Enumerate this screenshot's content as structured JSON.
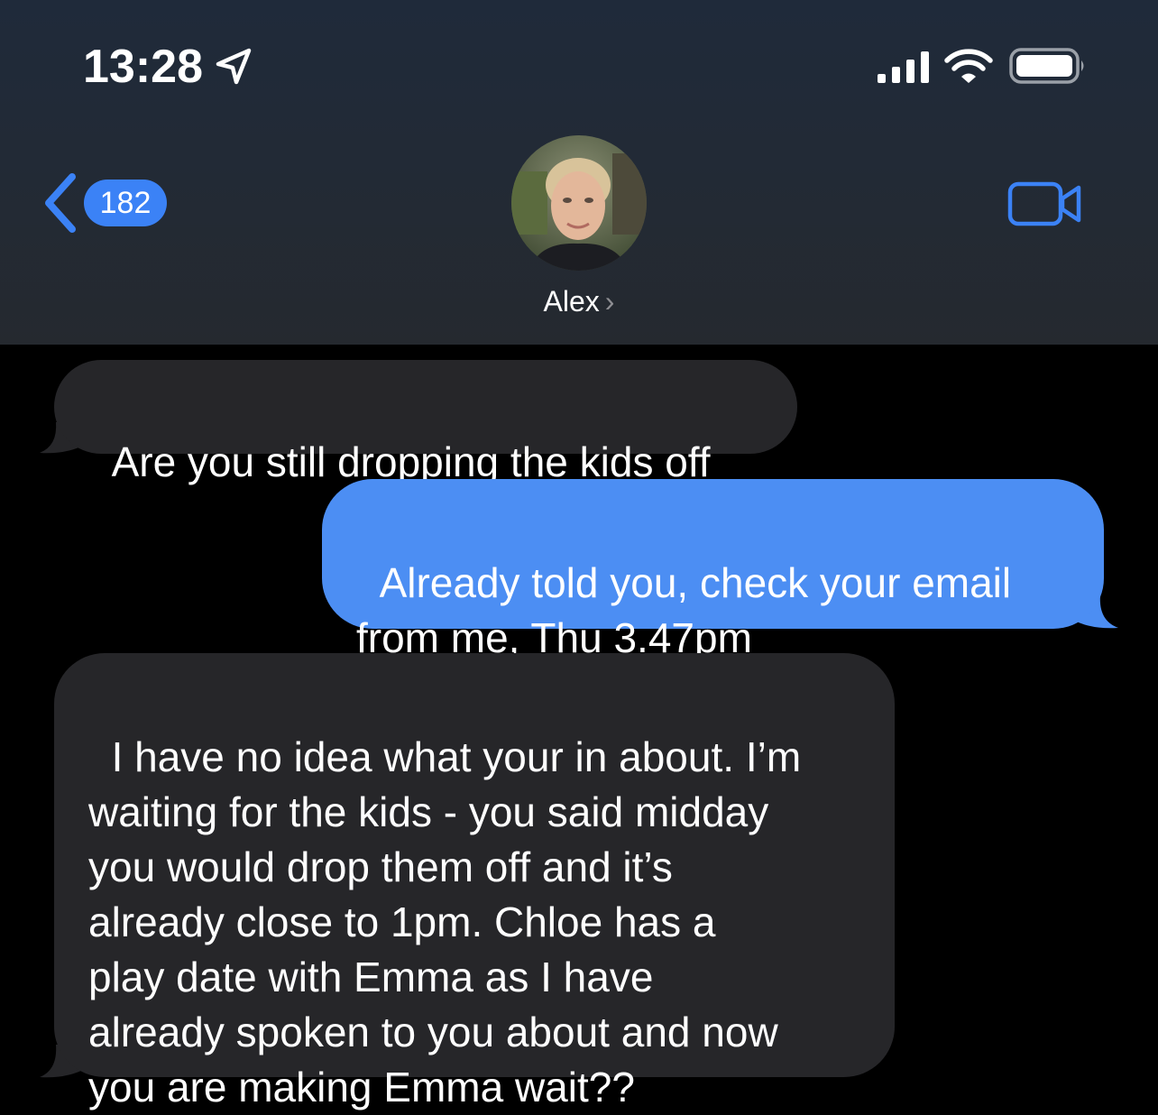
{
  "status_bar": {
    "time": "13:28",
    "location_icon": "location-arrow-icon",
    "signal_icon": "cellular-signal-icon",
    "wifi_icon": "wifi-icon",
    "battery_icon": "battery-icon"
  },
  "nav": {
    "back_icon": "chevron-left-icon",
    "back_badge": "182",
    "contact_name": "Alex",
    "contact_chevron": "›",
    "video_icon": "video-camera-icon"
  },
  "messages": [
    {
      "direction": "incoming",
      "text": "Are you still dropping the kids off"
    },
    {
      "direction": "outgoing",
      "text": "Already told you, check your email\nfrom me, Thu 3.47pm"
    },
    {
      "direction": "incoming",
      "text": "I have no idea what your in about. I’m\nwaiting for the kids - you said midday\nyou would drop them off and it’s\nalready close to 1pm. Chloe has a\nplay date with Emma as I have\nalready spoken to you about and now\nyou are making Emma wait??"
    }
  ],
  "colors": {
    "accent": "#3b82f6",
    "outgoing_bubble": "#4c8ef3",
    "incoming_bubble": "#262629",
    "background": "#000000"
  }
}
